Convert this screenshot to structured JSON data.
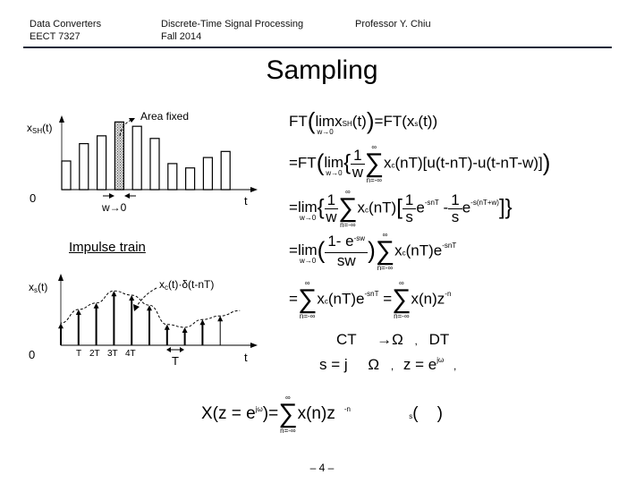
{
  "header": {
    "course_line1": "Data Converters",
    "course_line2": "EECT 7327",
    "topic_line1": "Discrete-Time Signal Processing",
    "topic_line2": "Fall 2014",
    "author": "Professor Y. Chiu",
    "rule_color": "#1b2a3a"
  },
  "slide_title": "Sampling",
  "figure_top": {
    "ylabel": "x",
    "ylabel_sub": "SH",
    "ylabel_arg": "(t)",
    "origin_label": "0",
    "xlabel": "t",
    "annotation": "Area fixed",
    "width_label": "w→0",
    "bar_heights": [
      0.33,
      0.53,
      0.62,
      0.78,
      0.73,
      0.59,
      0.3,
      0.25,
      0.37,
      0.44
    ],
    "highlighted_bar": 3
  },
  "impulse_label": "Impulse train",
  "figure_bottom": {
    "ylabel": "x",
    "ylabel_sub": "s",
    "ylabel_arg": "(t)",
    "annotation": "xₑ(t)·δ(t-nT)",
    "annotation_parts": {
      "x": "x",
      "sub": "c",
      "rest": "(t)·δ(t-nT)"
    },
    "origin_label": "0",
    "xlabel": "t",
    "tick_labels": [
      "T",
      "2T",
      "3T",
      "4T"
    ],
    "period_label": "T",
    "impulse_heights": [
      0.31,
      0.5,
      0.59,
      0.76,
      0.7,
      0.56,
      0.29,
      0.25,
      0.36,
      0.41
    ]
  },
  "equations": {
    "eq1": {
      "lhs_ft": "FT",
      "lim": "lim",
      "lim_sub": "w→0",
      "x": "x",
      "x_sub": "SH",
      "arg": "(t)",
      "eq": "=",
      "rhs_ft": "FT",
      "rhs_x": "x",
      "rhs_sub": "s",
      "rhs_arg": "(t)"
    },
    "eq2": {
      "prefix": "=FT",
      "lim": "lim",
      "lim_sub": "w→0",
      "frac_num": "1",
      "frac_den": "w",
      "sum_top": "∞",
      "sum_bot": "n=-∞",
      "term": "x",
      "term_sub": "c",
      "term_arg": "(nT)",
      "bracket": "[u(t-nT)-u(t-nT-w)]"
    },
    "eq3": {
      "prefix": "=",
      "lim": "lim",
      "lim_sub": "w→0",
      "frac_num": "1",
      "frac_den": "w",
      "sum_top": "∞",
      "sum_bot": "n=-∞",
      "term": "x",
      "term_sub": "c",
      "term_arg": "(nT)",
      "f1_num": "1",
      "f1_den": "s",
      "e1": "e",
      "e1_exp": "-snT",
      "minus": "-",
      "f2_num": "1",
      "f2_den": "s",
      "e2": "e",
      "e2_exp": "-s(nT+w)"
    },
    "eq4": {
      "prefix": "=",
      "lim": "lim",
      "lim_sub": "w→0",
      "frac_num": "1- e",
      "frac_num_exp": "-sw",
      "frac_den": "sw",
      "sum_top": "∞",
      "sum_bot": "n=-∞",
      "term": "x",
      "term_sub": "c",
      "term_arg": "(nT)e",
      "term_exp": "-snT"
    },
    "eq5": {
      "prefix": "=",
      "sum_top": "∞",
      "sum_bot": "n=-∞",
      "term": "x",
      "term_sub": "c",
      "term_arg": "(nT)e",
      "term_exp": "-snT",
      "eq": "=",
      "sum2_top": "∞",
      "sum2_bot": "n=-∞",
      "term2": "x(n)z",
      "term2_exp": "-n"
    },
    "eq6": {
      "ct": "CT",
      "arrow": "→Ω",
      "comma": ",",
      "dt": "DT"
    },
    "eq7": {
      "text": "s = j",
      "omega": "Ω",
      "comma": ",",
      "z": "z = e",
      "z_exp": "jω",
      "comma2": ","
    },
    "eq8": {
      "lhs": "X(z = e",
      "lhs_exp": "jω",
      "lhs_close": ")=",
      "sum_top": "∞",
      "sum_bot": "n=-∞",
      "term": "x(n)z",
      "term_exp": "-n",
      "trail_sub": "s",
      "trail": "(    )"
    }
  },
  "page_number": "– 4 –"
}
